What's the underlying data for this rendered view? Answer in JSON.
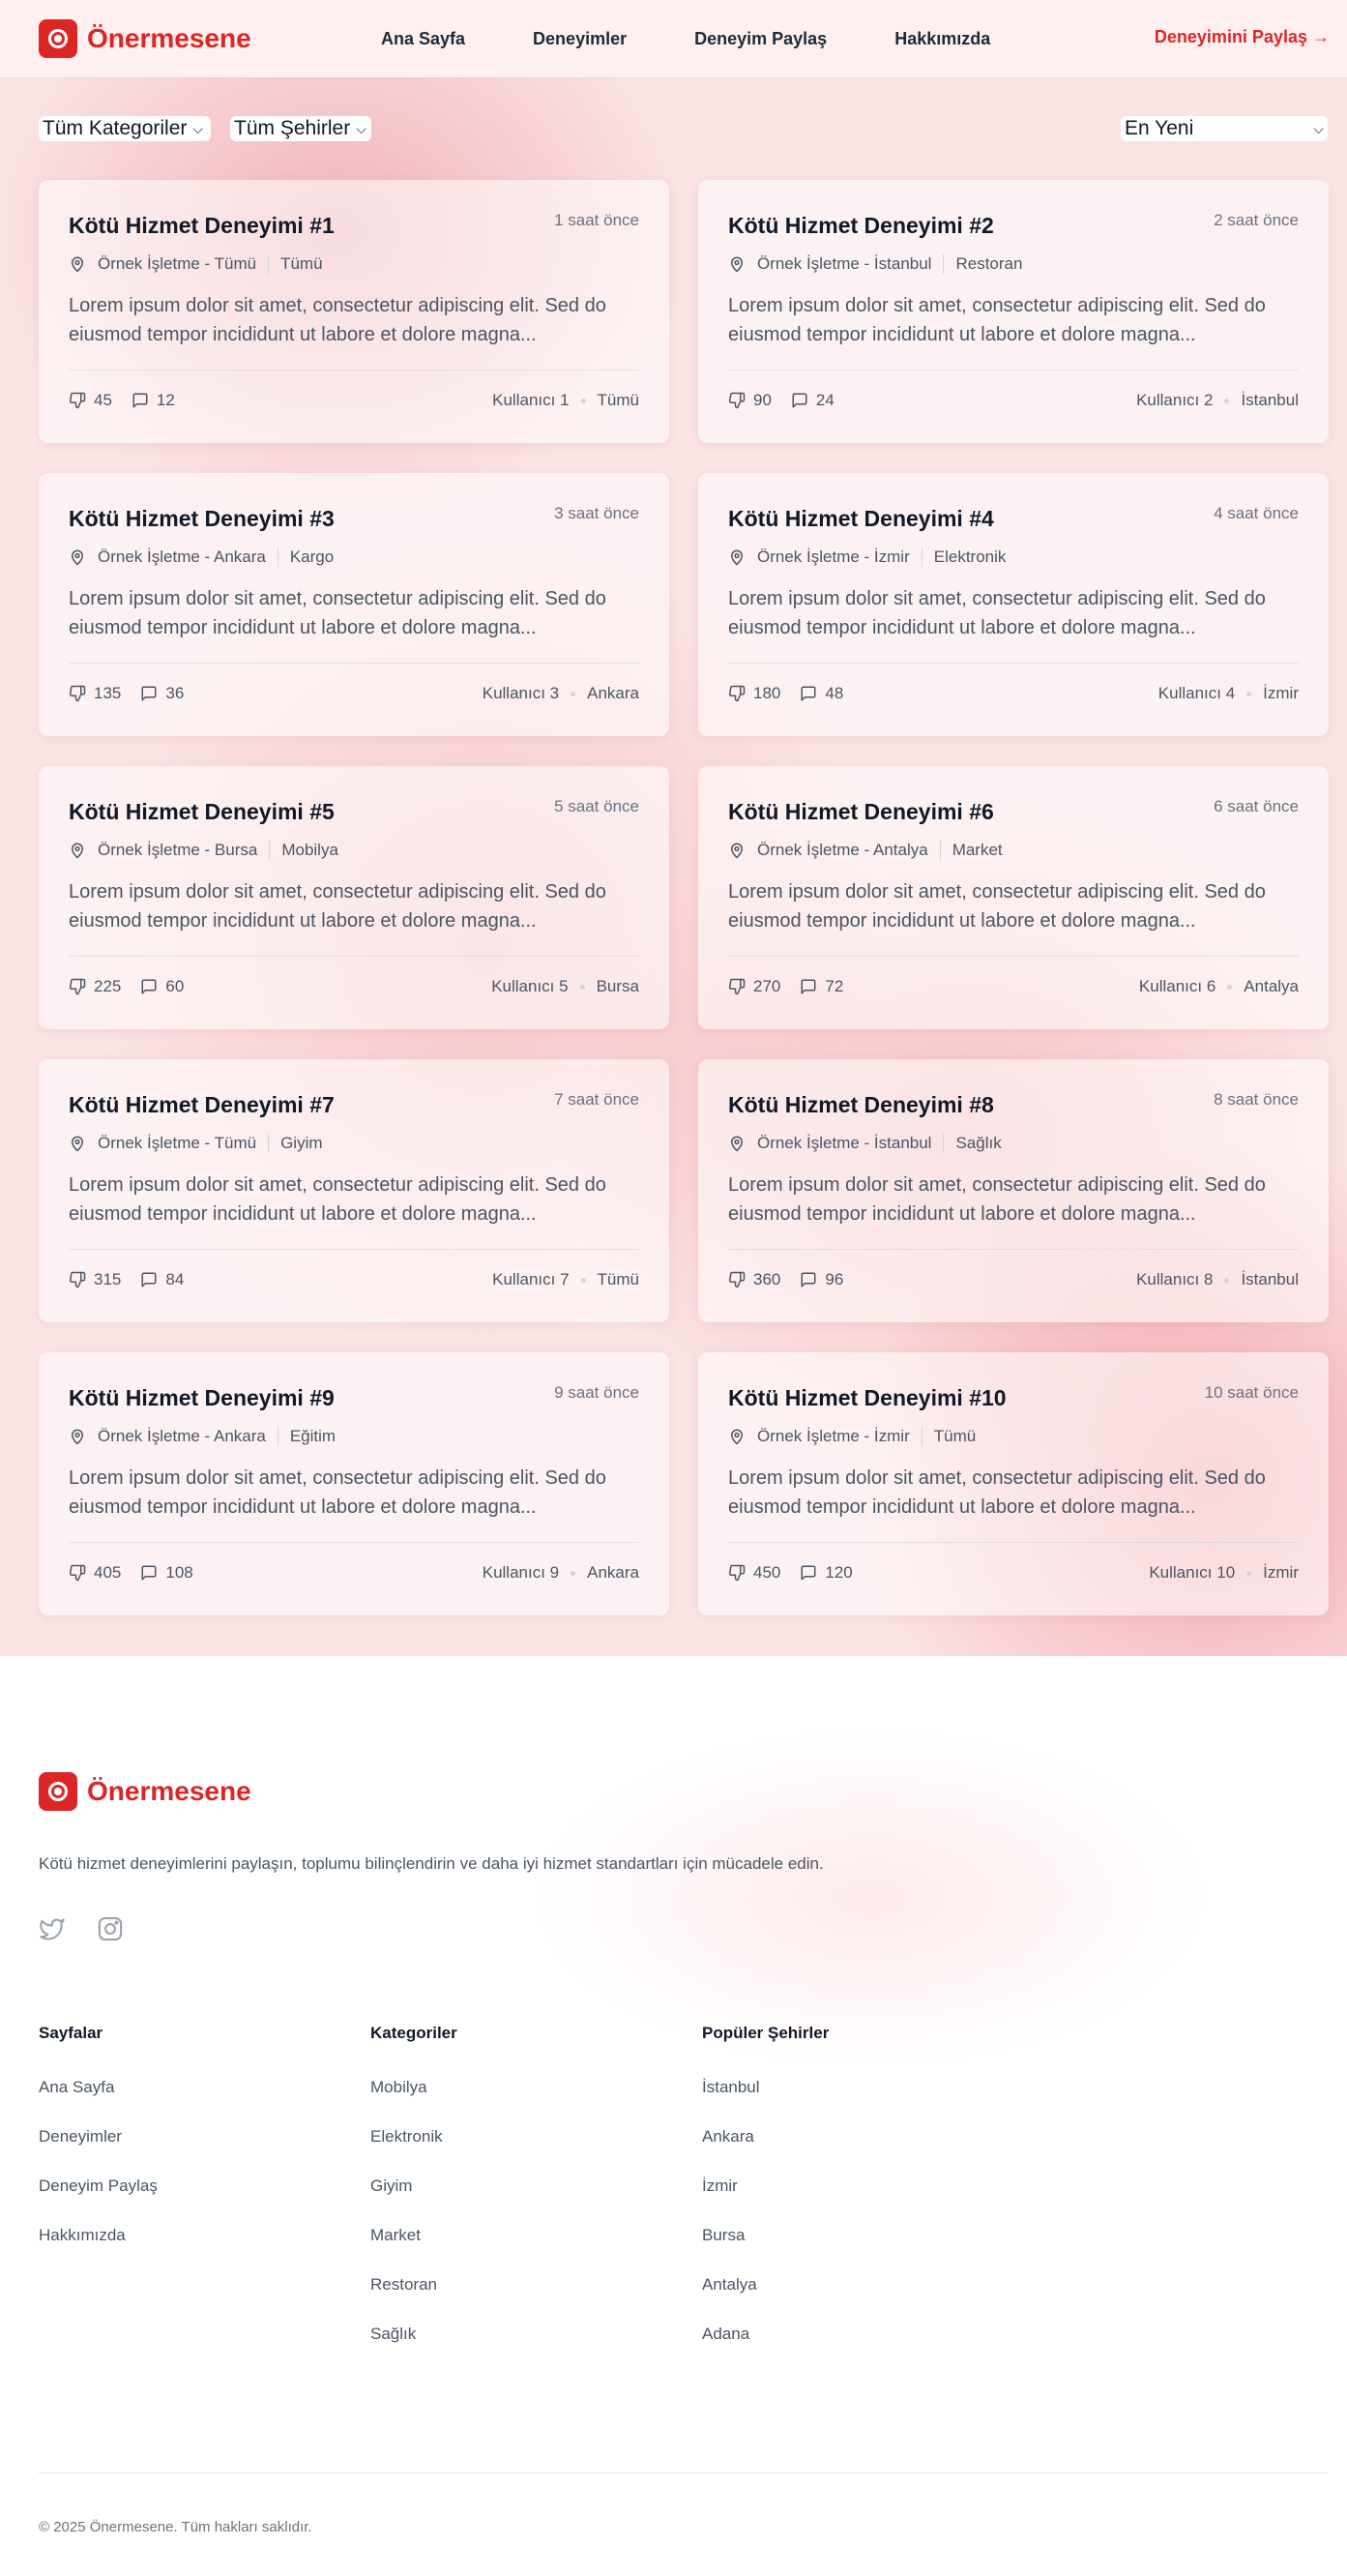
{
  "header": {
    "logo_text": "Önermesene",
    "nav": [
      "Ana Sayfa",
      "Deneyimler",
      "Deneyim Paylaş",
      "Hakkımızda"
    ],
    "share_link": "Deneyimini Paylaş →"
  },
  "filters": {
    "category": "Tüm Kategoriler",
    "city": "Tüm Şehirler",
    "sort": "En Yeni"
  },
  "cards": [
    {
      "title": "Kötü Hizmet Deneyimi #1",
      "time": "1 saat önce",
      "business": "Örnek İşletme - Tümü",
      "category": "Tümü",
      "desc": "Lorem ipsum dolor sit amet, consectetur adipiscing elit. Sed do eiusmod tempor incididunt ut labore et dolore magna...",
      "likes": "45",
      "comments": "12",
      "user": "Kullanıcı 1",
      "city": "Tümü"
    },
    {
      "title": "Kötü Hizmet Deneyimi #2",
      "time": "2 saat önce",
      "business": "Örnek İşletme - İstanbul",
      "category": "Restoran",
      "desc": "Lorem ipsum dolor sit amet, consectetur adipiscing elit. Sed do eiusmod tempor incididunt ut labore et dolore magna...",
      "likes": "90",
      "comments": "24",
      "user": "Kullanıcı 2",
      "city": "İstanbul"
    },
    {
      "title": "Kötü Hizmet Deneyimi #3",
      "time": "3 saat önce",
      "business": "Örnek İşletme - Ankara",
      "category": "Kargo",
      "desc": "Lorem ipsum dolor sit amet, consectetur adipiscing elit. Sed do eiusmod tempor incididunt ut labore et dolore magna...",
      "likes": "135",
      "comments": "36",
      "user": "Kullanıcı 3",
      "city": "Ankara"
    },
    {
      "title": "Kötü Hizmet Deneyimi #4",
      "time": "4 saat önce",
      "business": "Örnek İşletme - İzmir",
      "category": "Elektronik",
      "desc": "Lorem ipsum dolor sit amet, consectetur adipiscing elit. Sed do eiusmod tempor incididunt ut labore et dolore magna...",
      "likes": "180",
      "comments": "48",
      "user": "Kullanıcı 4",
      "city": "İzmir"
    },
    {
      "title": "Kötü Hizmet Deneyimi #5",
      "time": "5 saat önce",
      "business": "Örnek İşletme - Bursa",
      "category": "Mobilya",
      "desc": "Lorem ipsum dolor sit amet, consectetur adipiscing elit. Sed do eiusmod tempor incididunt ut labore et dolore magna...",
      "likes": "225",
      "comments": "60",
      "user": "Kullanıcı 5",
      "city": "Bursa"
    },
    {
      "title": "Kötü Hizmet Deneyimi #6",
      "time": "6 saat önce",
      "business": "Örnek İşletme - Antalya",
      "category": "Market",
      "desc": "Lorem ipsum dolor sit amet, consectetur adipiscing elit. Sed do eiusmod tempor incididunt ut labore et dolore magna...",
      "likes": "270",
      "comments": "72",
      "user": "Kullanıcı 6",
      "city": "Antalya"
    },
    {
      "title": "Kötü Hizmet Deneyimi #7",
      "time": "7 saat önce",
      "business": "Örnek İşletme - Tümü",
      "category": "Giyim",
      "desc": "Lorem ipsum dolor sit amet, consectetur adipiscing elit. Sed do eiusmod tempor incididunt ut labore et dolore magna...",
      "likes": "315",
      "comments": "84",
      "user": "Kullanıcı 7",
      "city": "Tümü"
    },
    {
      "title": "Kötü Hizmet Deneyimi #8",
      "time": "8 saat önce",
      "business": "Örnek İşletme - İstanbul",
      "category": "Sağlık",
      "desc": "Lorem ipsum dolor sit amet, consectetur adipiscing elit. Sed do eiusmod tempor incididunt ut labore et dolore magna...",
      "likes": "360",
      "comments": "96",
      "user": "Kullanıcı 8",
      "city": "İstanbul"
    },
    {
      "title": "Kötü Hizmet Deneyimi #9",
      "time": "9 saat önce",
      "business": "Örnek İşletme - Ankara",
      "category": "Eğitim",
      "desc": "Lorem ipsum dolor sit amet, consectetur adipiscing elit. Sed do eiusmod tempor incididunt ut labore et dolore magna...",
      "likes": "405",
      "comments": "108",
      "user": "Kullanıcı 9",
      "city": "Ankara"
    },
    {
      "title": "Kötü Hizmet Deneyimi #10",
      "time": "10 saat önce",
      "business": "Örnek İşletme - İzmir",
      "category": "Tümü",
      "desc": "Lorem ipsum dolor sit amet, consectetur adipiscing elit. Sed do eiusmod tempor incididunt ut labore et dolore magna...",
      "likes": "450",
      "comments": "120",
      "user": "Kullanıcı 10",
      "city": "İzmir"
    }
  ],
  "footer": {
    "logo_text": "Önermesene",
    "description": "Kötü hizmet deneyimlerini paylaşın, toplumu bilinçlendirin ve daha iyi hizmet standartları için mücadele edin.",
    "social_icons": [
      "twitter-icon",
      "instagram-icon"
    ],
    "columns": [
      {
        "heading": "Sayfalar",
        "links": [
          "Ana Sayfa",
          "Deneyimler",
          "Deneyim Paylaş",
          "Hakkımızda"
        ]
      },
      {
        "heading": "Kategoriler",
        "links": [
          "Mobilya",
          "Elektronik",
          "Giyim",
          "Market",
          "Restoran",
          "Sağlık"
        ]
      },
      {
        "heading": "Popüler Şehirler",
        "links": [
          "İstanbul",
          "Ankara",
          "İzmir",
          "Bursa",
          "Antalya",
          "Adana"
        ]
      }
    ],
    "copyright": "© 2025 Önermesene. Tüm hakları saklıdır."
  },
  "colors": {
    "brand": "#dc2626",
    "text": "#111827",
    "muted": "#4b5563"
  }
}
